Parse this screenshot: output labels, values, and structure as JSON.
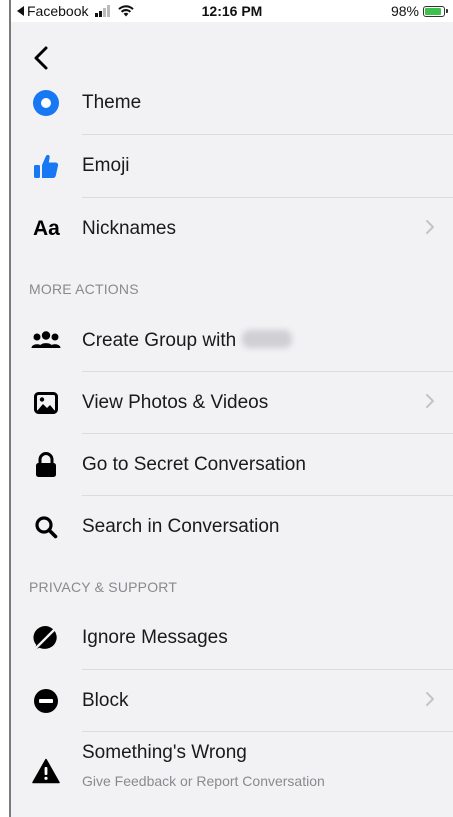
{
  "status_bar": {
    "back_app": "Facebook",
    "time": "12:16 PM",
    "battery": "98%",
    "battery_level": 0.98,
    "signal_bars": 2
  },
  "colors": {
    "accent": "#1877f2",
    "background": "#f2f2f4",
    "separator": "#dcdcdf",
    "section_text": "#8a8a8e",
    "chevron": "#c4c4c7"
  },
  "nav": {
    "back_icon": "chevron-left-icon"
  },
  "customize": {
    "items": [
      {
        "label": "Theme",
        "icon": "theme-circle-icon"
      },
      {
        "label": "Emoji",
        "icon": "thumbs-up-icon"
      },
      {
        "label": "Nicknames",
        "icon": "aa-text-icon",
        "icon_text": "Aa"
      }
    ]
  },
  "more_actions": {
    "header": "MORE ACTIONS",
    "items": [
      {
        "label": "Create Group with",
        "icon": "people-group-icon"
      },
      {
        "label": "View Photos & Videos",
        "icon": "photo-icon"
      },
      {
        "label": "Go to Secret Conversation",
        "icon": "lock-icon"
      },
      {
        "label": "Search in Conversation",
        "icon": "search-icon"
      }
    ]
  },
  "privacy_support": {
    "header": "PRIVACY & SUPPORT",
    "items": [
      {
        "label": "Ignore Messages",
        "icon": "ignore-bubble-icon"
      },
      {
        "label": "Block",
        "icon": "block-icon"
      },
      {
        "label": "Something's Wrong",
        "subtitle": "Give Feedback or Report Conversation",
        "icon": "warning-icon"
      }
    ]
  }
}
